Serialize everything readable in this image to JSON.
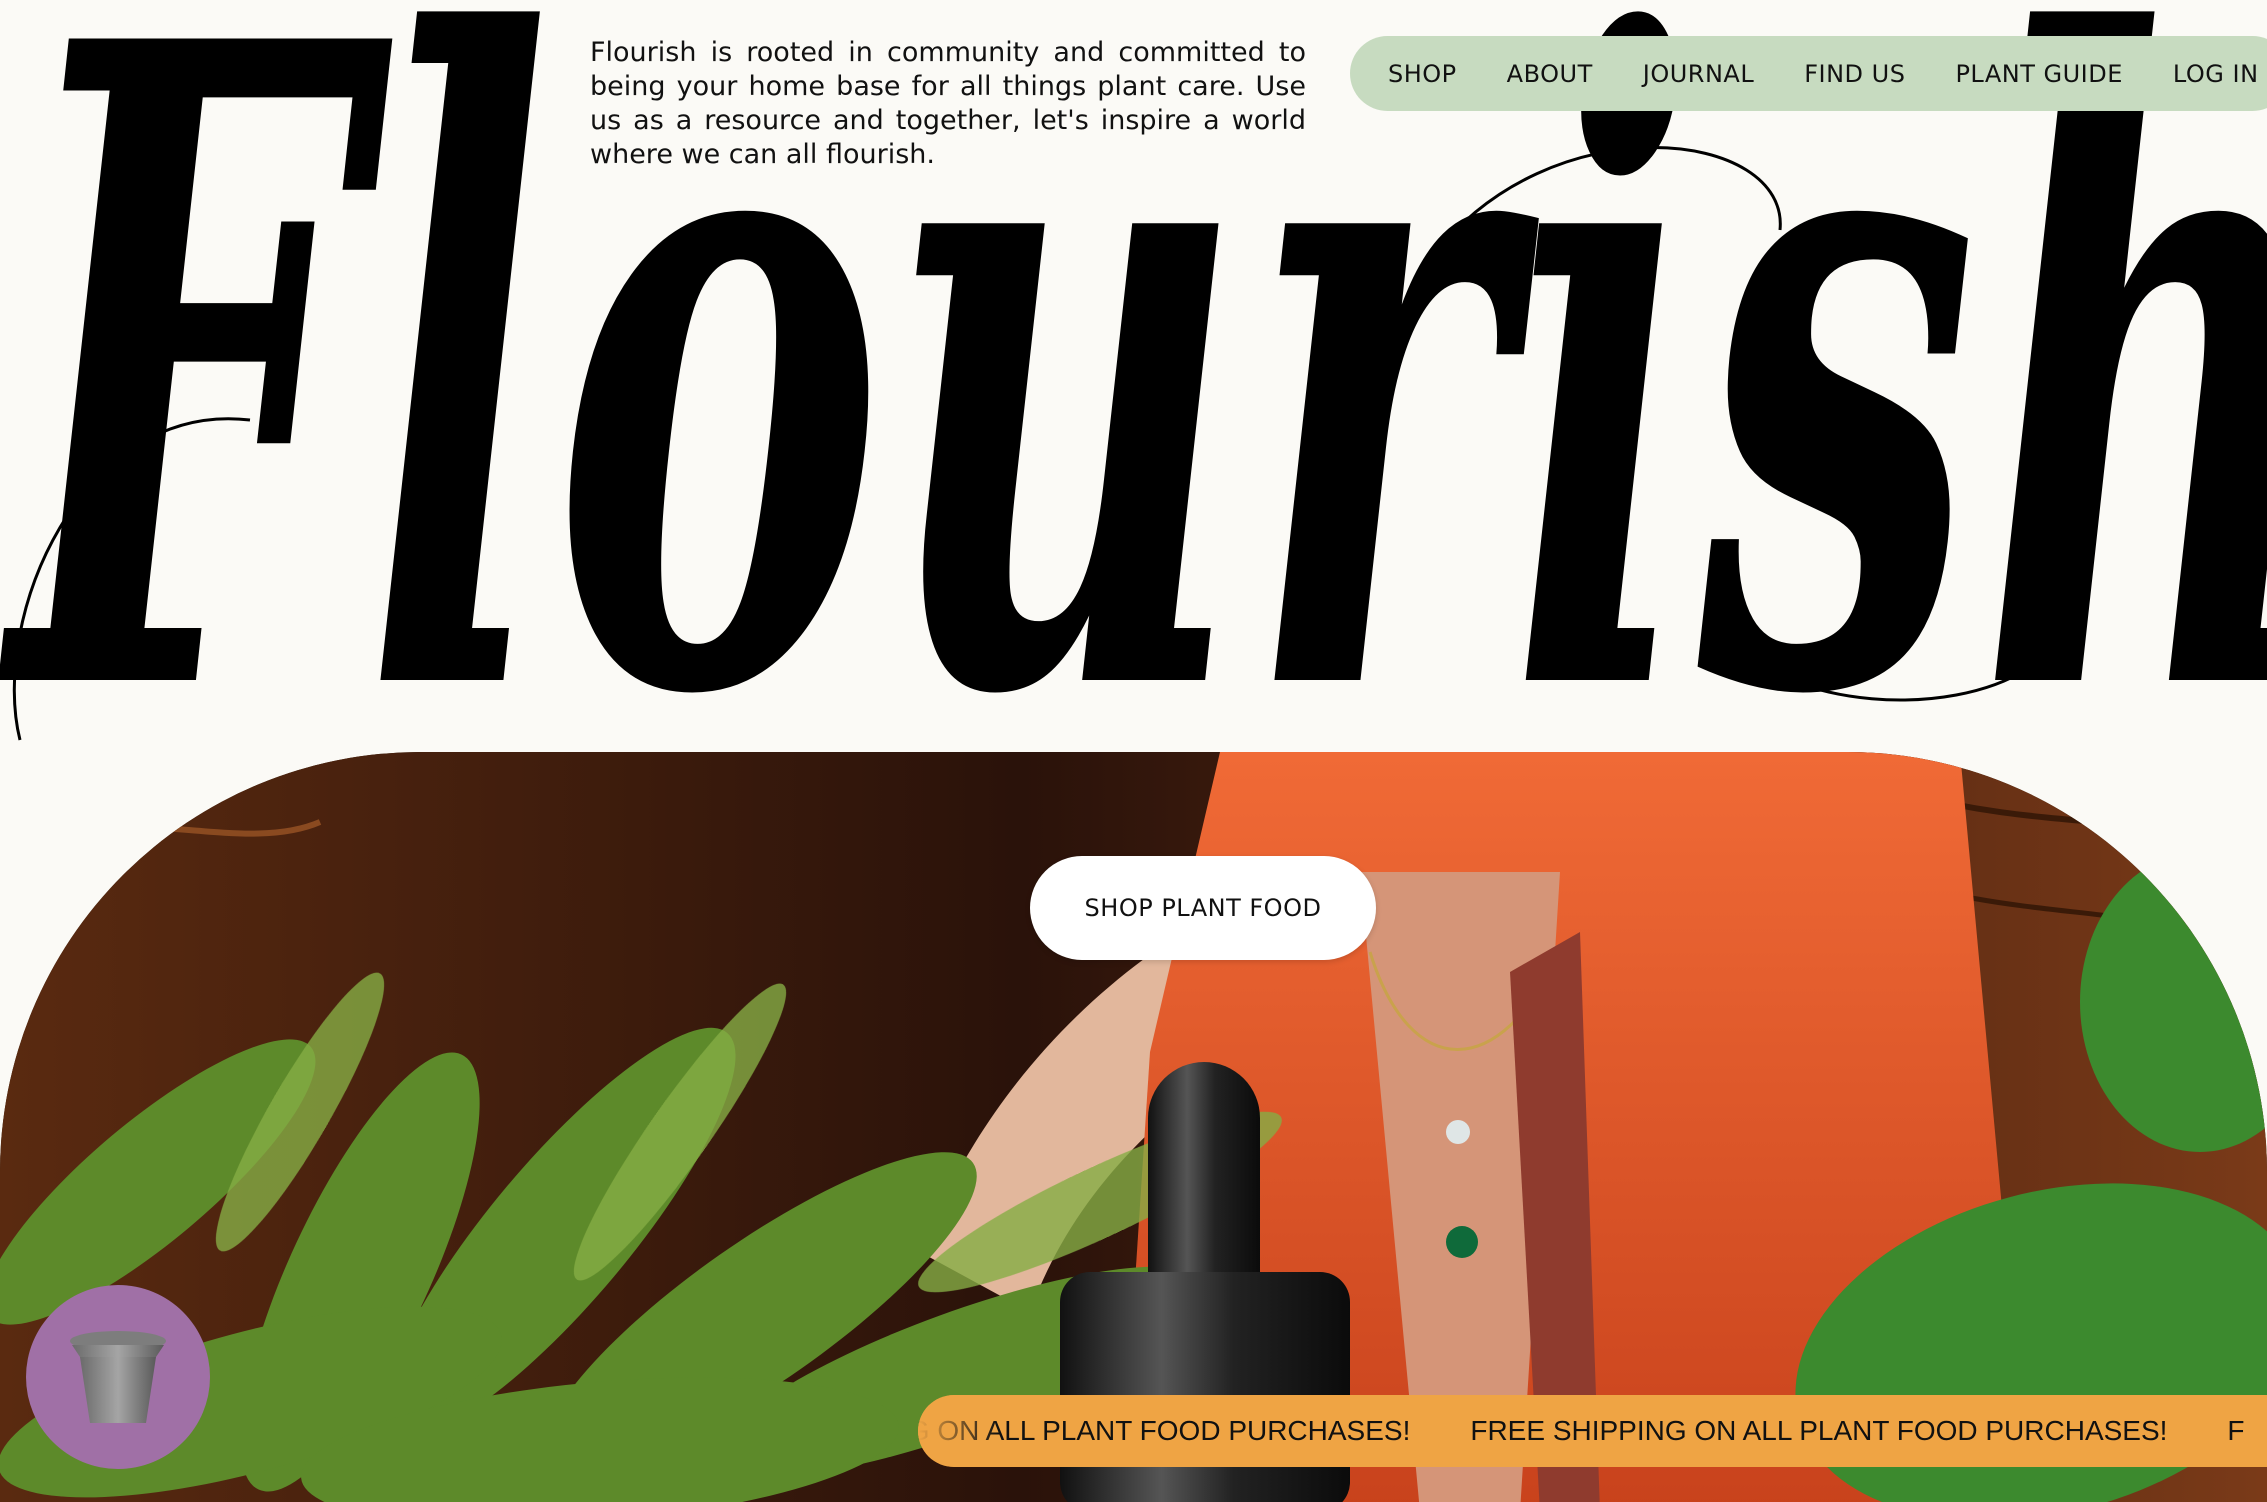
{
  "brand": {
    "wordmark": "Flourish"
  },
  "intro": {
    "text": "Flourish is rooted in community and committed to being your home base for all things plant care. Use us as a resource and together, let's inspire a world where we can all flourish."
  },
  "nav": {
    "items": [
      {
        "label": "SHOP"
      },
      {
        "label": "ABOUT"
      },
      {
        "label": "JOURNAL"
      },
      {
        "label": "FIND US"
      },
      {
        "label": "PLANT GUIDE"
      },
      {
        "label": "LOG IN"
      }
    ]
  },
  "hero": {
    "cta_label": "SHOP PLANT FOOD"
  },
  "marquee": {
    "lead": "IG ON ALL PLANT FOOD PURCHASES!",
    "message": "FREE SHIPPING ON ALL PLANT FOOD PURCHASES!",
    "tail": "F"
  },
  "colors": {
    "background": "#fbfaf6",
    "nav_pill": "#c7dbc0",
    "marquee": "#efa444",
    "cart_bubble": "#a070a6",
    "robe": "#e8572a"
  },
  "icons": {
    "cart": "flower-pot-icon"
  }
}
